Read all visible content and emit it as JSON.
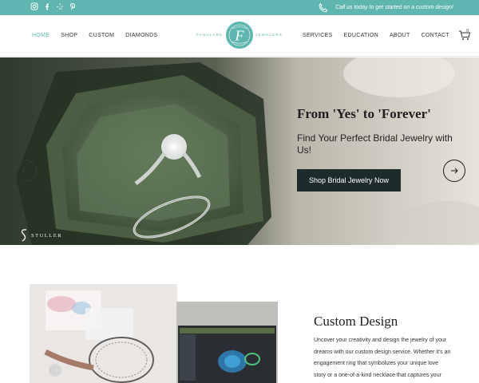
{
  "topbar": {
    "social_icons": [
      "instagram-icon",
      "facebook-icon",
      "yelp-icon",
      "pinterest-icon"
    ],
    "call_text": "Call us today to get started on a custom design!"
  },
  "nav": {
    "left": [
      "HOME",
      "SHOP",
      "CUSTOM",
      "DIAMONDS"
    ],
    "right": [
      "SERVICES",
      "EDUCATION",
      "ABOUT",
      "CONTACT"
    ],
    "active": "HOME",
    "logo_left": "FANULARE",
    "logo_right": "JEWELERS",
    "logo_letter": "F",
    "cart_count": "0"
  },
  "hero": {
    "title": "From 'Yes' to 'Forever'",
    "subtitle": "Find Your Perfect Bridal Jewelry with Us!",
    "button": "Shop Bridal Jewelry Now",
    "brand": "STULLER"
  },
  "custom_design": {
    "title": "Custom Design",
    "body": "Uncover your creativity and design the jewelry of your dreams with our custom design service. Whether it's an engagement ring that symbolizes your unique love story or a one-of-a-kind necklace that captures your personal"
  },
  "colors": {
    "accent": "#5fb6ae",
    "button_bg": "#1e2b2b"
  }
}
